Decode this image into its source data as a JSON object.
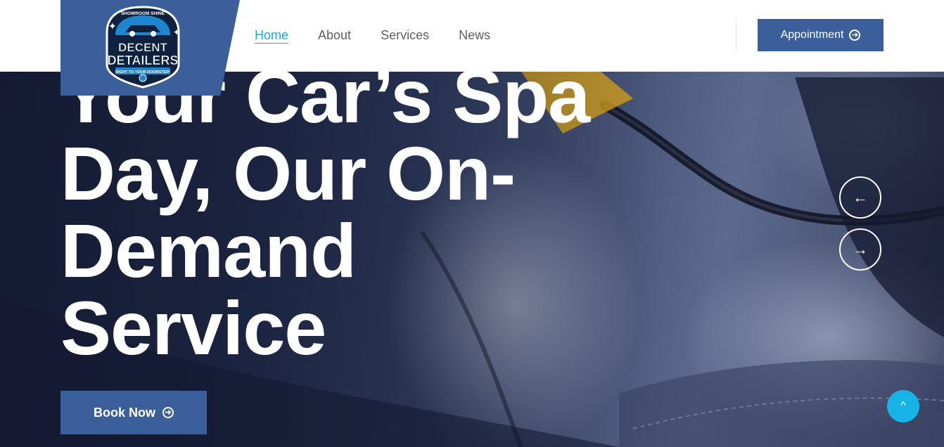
{
  "brand": {
    "top_text": "SHOWROOM SHINE",
    "name_line1": "DECENT",
    "name_line2": "DETAILERS",
    "tagline": "RIGHT TO YOUR DOORSTEP!"
  },
  "nav": {
    "items": [
      {
        "label": "Home",
        "active": true
      },
      {
        "label": "About",
        "active": false
      },
      {
        "label": "Services",
        "active": false
      },
      {
        "label": "News",
        "active": false
      }
    ]
  },
  "header": {
    "appointment_label": "Appointment"
  },
  "hero": {
    "headline_line1": "Your Car’s Spa",
    "headline_line2": "Day, Our On-",
    "headline_line3": "Demand",
    "headline_line4": "Service",
    "cta_label": "Book Now"
  },
  "slider": {
    "prev_icon": "←",
    "next_icon": "→"
  },
  "back_to_top_icon": "^",
  "colors": {
    "primary": "#3a5f9a",
    "accent": "#17a9df",
    "back_to_top": "#16b4e6"
  }
}
